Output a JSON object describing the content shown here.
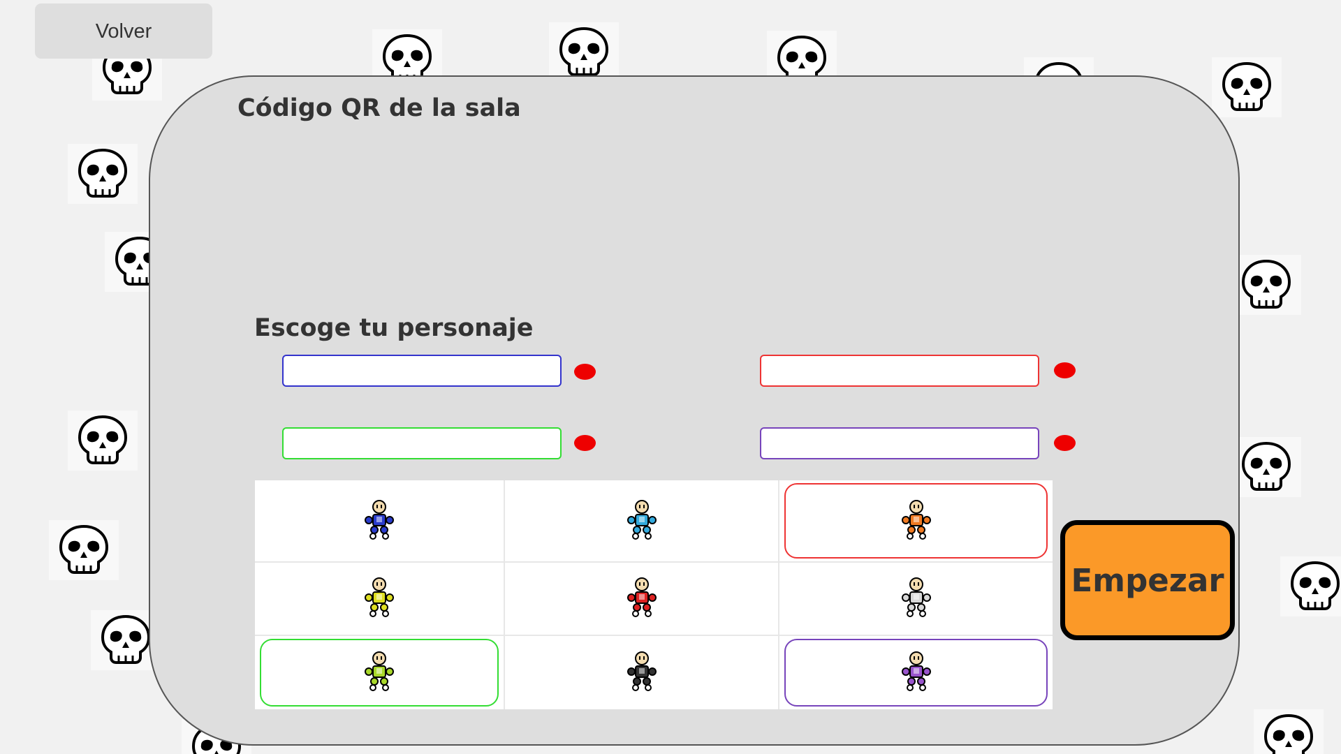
{
  "nav": {
    "back_label": "Volver"
  },
  "panel": {
    "qr_title": "Código QR de la sala",
    "choose_title": "Escoge tu personaje"
  },
  "players": [
    {
      "name": "",
      "border_color": "#3333cc",
      "ready": false
    },
    {
      "name": "",
      "border_color": "#ee3333",
      "ready": false
    },
    {
      "name": "",
      "border_color": "#33dd33",
      "ready": false
    },
    {
      "name": "",
      "border_color": "#7744bb",
      "ready": false
    }
  ],
  "status_dot_color": "#ee0000",
  "characters": [
    {
      "id": "navy",
      "color": "#2a3ccc",
      "selected_by": null
    },
    {
      "id": "cyan",
      "color": "#33aadd",
      "selected_by": null
    },
    {
      "id": "orange",
      "color": "#f07a22",
      "selected_by": "#ee3333"
    },
    {
      "id": "yellow",
      "color": "#dede22",
      "selected_by": null
    },
    {
      "id": "red",
      "color": "#dd2222",
      "selected_by": null
    },
    {
      "id": "white",
      "color": "#d8d8d8",
      "selected_by": null
    },
    {
      "id": "lime",
      "color": "#a8d82a",
      "selected_by": "#33dd33"
    },
    {
      "id": "black",
      "color": "#333333",
      "selected_by": null
    },
    {
      "id": "purple",
      "color": "#9955cc",
      "selected_by": "#7744bb"
    }
  ],
  "start_label": "Empezar",
  "colors": {
    "start_button": "#fb9928",
    "panel_bg": "#dedede",
    "page_bg": "#f1f1f1"
  },
  "background_icon": "skull-icon"
}
